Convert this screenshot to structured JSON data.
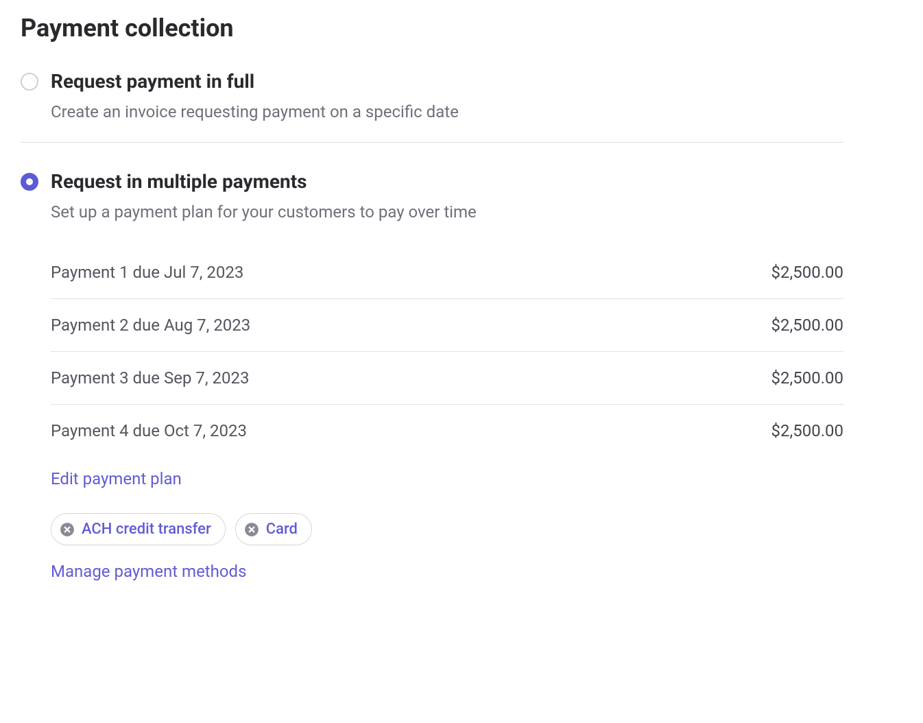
{
  "title": "Payment collection",
  "options": {
    "full": {
      "label": "Request payment in full",
      "desc": "Create an invoice requesting payment on a specific date"
    },
    "multiple": {
      "label": "Request in multiple payments",
      "desc": "Set up a payment plan for your customers to pay over time"
    }
  },
  "payments": [
    {
      "label": "Payment 1 due Jul 7, 2023",
      "amount": "$2,500.00"
    },
    {
      "label": "Payment 2 due Aug 7, 2023",
      "amount": "$2,500.00"
    },
    {
      "label": "Payment 3 due Sep 7, 2023",
      "amount": "$2,500.00"
    },
    {
      "label": "Payment 4 due Oct 7, 2023",
      "amount": "$2,500.00"
    }
  ],
  "links": {
    "edit_payment_plan": "Edit payment plan",
    "manage_methods": "Manage payment methods"
  },
  "chips": [
    {
      "label": "ACH credit transfer"
    },
    {
      "label": "Card"
    }
  ],
  "colors": {
    "accent": "#625bd6",
    "text": "#2a2a2e",
    "muted": "#6f6f7a",
    "border": "#e2e2e4"
  }
}
